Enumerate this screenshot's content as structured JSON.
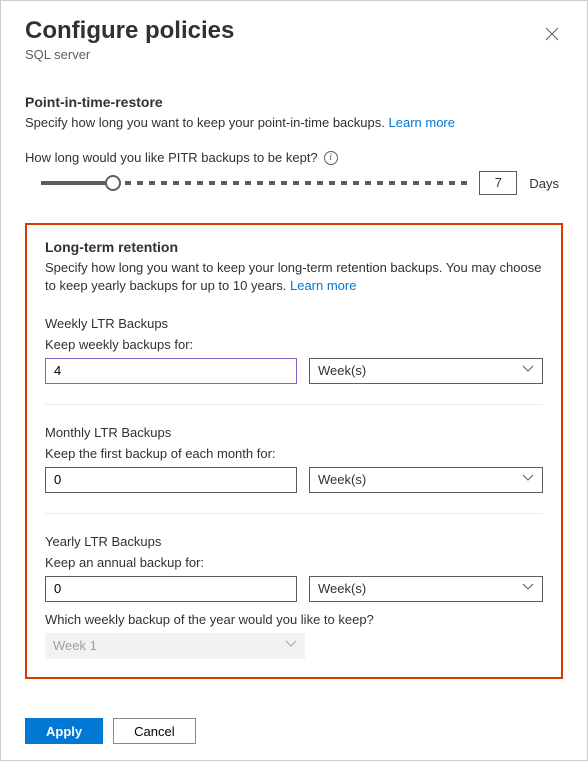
{
  "header": {
    "title": "Configure policies",
    "subtitle": "SQL server"
  },
  "pitr": {
    "section_title": "Point-in-time-restore",
    "description": "Specify how long you want to keep your point-in-time backups.",
    "learn_more": "Learn more",
    "slider_label": "How long would you like PITR backups to be kept?",
    "value": "7",
    "unit": "Days"
  },
  "ltr": {
    "section_title": "Long-term retention",
    "description": "Specify how long you want to keep your long-term retention backups. You may choose to keep yearly backups for up to 10 years.",
    "learn_more": "Learn more",
    "weekly": {
      "title": "Weekly LTR Backups",
      "label": "Keep weekly backups for:",
      "value": "4",
      "unit": "Week(s)"
    },
    "monthly": {
      "title": "Monthly LTR Backups",
      "label": "Keep the first backup of each month for:",
      "value": "0",
      "unit": "Week(s)"
    },
    "yearly": {
      "title": "Yearly LTR Backups",
      "label": "Keep an annual backup for:",
      "value": "0",
      "unit": "Week(s)",
      "week_question": "Which weekly backup of the year would you like to keep?",
      "week_value": "Week 1"
    }
  },
  "footer": {
    "apply": "Apply",
    "cancel": "Cancel"
  }
}
